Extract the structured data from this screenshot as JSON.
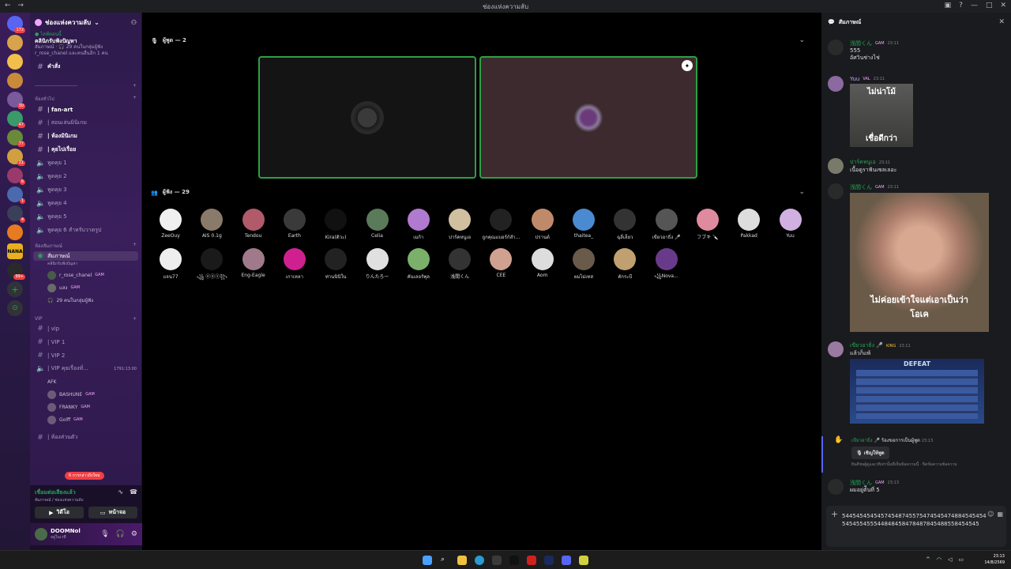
{
  "window": {
    "title": "ช่องแห่งความลับ"
  },
  "server": {
    "name": "ช่องแห่งความลับ"
  },
  "event": {
    "live": "● ไลฟ์ตอนนี้",
    "title": "คลินิกรับฟังปัญหา",
    "detail": "สัมภาษณ์ · 🎧 29 คนในกลุ่มผู้ฟัง",
    "detail2": "r_rose_chanel และคนอื่นอีก 1 คน"
  },
  "cmd_channel": "คำสั่ง",
  "categories": {
    "general": "ห้องทั่วไป",
    "stage": "ห้องสัมภาษณ์",
    "vip": "VIP"
  },
  "text_channels": [
    "| fan-art",
    "| สอนเล่นมินิเกม",
    "| ห้องมินิเกม",
    "| คุยไปเรื่อย"
  ],
  "voice_channels": [
    "พูดคุย 1",
    "พูดคุย 2",
    "พูดคุย 3",
    "พูดคุย 4",
    "พูดคุย 5",
    "พูดคุย 6 สำหรับวาดรูป"
  ],
  "stage_channel": {
    "name": "สัมภาษณ์",
    "topic": "คลินิกรับฟังปัญหา",
    "speakers": [
      "r_rose_chanel",
      "แสง"
    ],
    "listeners": "29 คนในกลุ่มผู้ฟัง"
  },
  "vip_channels": [
    "| vip",
    "| VIP 1",
    "| VIP 2",
    "| VIP คุยเรื่องทั่..."
  ],
  "vip_timer": "1791:13:00",
  "vip_users": [
    "AFK",
    "BASHUNE",
    "FRANKY",
    "Golff"
  ],
  "private_channel": "| ห้องส่วนตัว",
  "unread": "6 การกล่าวถึงใหม่",
  "voice_status": {
    "state": "เชื่อมต่อเสียงแล้ว",
    "where": "สัมภาษณ์ / ช่องแห่งความลับ"
  },
  "panel_buttons": {
    "video": "วิดีโอ",
    "screen": "หน้าจอ"
  },
  "me": {
    "name": "DOOMNol",
    "status": "อยู่ในเวที"
  },
  "stage": {
    "speakers_label": "ผู้พูด — 2",
    "audience_label": "ผู้ฟัง — 29"
  },
  "audience": [
    "ZeeOuy",
    "AIS 0.1g",
    "Tendou",
    "Earth",
    "Kira(ดิวะ)",
    "Celia",
    "เมก้า",
    "ปาร์คหนูเอ",
    "ถูกคุณแบอร์ก์สำ...",
    "ปรานต์",
    "thaitea_",
    "ฉุลี่เล็ยว",
    "เขียวอาธิ่ง 🎤",
    "フブキ 🔪",
    "Pakkad",
    "Yuu",
    "แจน77",
    "꧁ ⓔⓞⓢ꧂",
    "Eng-Eagle",
    "เกาเหลา",
    "ท่านนินิใน",
    "りんたろー",
    "คันเลอร์พุล",
    "浅間くん",
    "CEE",
    "Aom",
    "ผมไม่เทส",
    "ตักระบี",
    "꧁Nova..."
  ],
  "chat": {
    "title": "สัมภาษณ์",
    "messages": [
      {
        "user": "浅間くん",
        "tag": "GAM",
        "time": "23:11",
        "lines": [
          "555",
          "อัศวินช่างไช่"
        ]
      },
      {
        "user": "Yuu",
        "tag": "VAL",
        "time": "23:11",
        "image_text": [
          "ไม่น่าโม้",
          "เชื่อดีกว่า"
        ]
      },
      {
        "user": "ปาร์คหนูเอ",
        "tag": "",
        "time": "23:11",
        "lines": [
          "เนื้อดูราฟันเซลเลอะ"
        ]
      },
      {
        "user": "浅間くん",
        "tag": "GAM",
        "time": "23:11",
        "image_text": [
          "ไม่ค่อยเข้าใจแต่เอาเป็นว่า",
          "โอเค"
        ]
      },
      {
        "user": "เขียวอาธิ่ง 🎤",
        "tag": "KING",
        "time": "23:11",
        "lines": [
          "แล้วก็แพ้"
        ],
        "image_text": [
          "DEFEAT"
        ]
      },
      {
        "user": "浅間くん",
        "tag": "GAM",
        "time": "23:13",
        "lines": [
          "ผมอยู่ตัีนที่ 5"
        ]
      }
    ],
    "request": {
      "user": "เขียวอาธิ่ง 🎤",
      "text": "ร้องขอการเป็นผู้พูด",
      "time": "23:13",
      "button": "เชิญให้พูด",
      "note": "ยินดีชนผู้ดูแลเวทีเท่านั้นที่เห็นข้อความนี้ · ปิดข้อความข้อความ"
    },
    "input_text": "54454545454574548745575474545474884545454545455455544848458478487845488558454545"
  },
  "clock": {
    "time": "23:13",
    "date": "14/8/2569"
  }
}
